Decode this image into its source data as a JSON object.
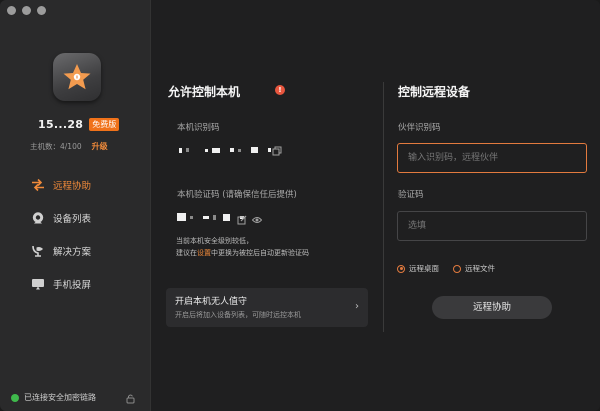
{
  "sidebar": {
    "device_id": "15...28",
    "plan_badge": "免费版",
    "hosts_label": "主机数：4/100",
    "upgrade_label": "升级",
    "nav": [
      {
        "label": "远程协助",
        "icon": "remote-assist-icon",
        "active": true
      },
      {
        "label": "设备列表",
        "icon": "device-list-icon",
        "active": false
      },
      {
        "label": "解决方案",
        "icon": "solutions-icon",
        "active": false
      },
      {
        "label": "手机投屏",
        "icon": "screen-mirror-icon",
        "active": false
      }
    ],
    "status_text": "已连接安全加密链路"
  },
  "allow": {
    "title": "允许控制本机",
    "id_label": "本机识别码",
    "code_label": "本机验证码 (请确保信任后提供)",
    "hint_line1": "当前本机安全级别较低，",
    "hint_line2_pre": "建议在",
    "hint_line2_link": "设置",
    "hint_line2_post": "中更换为被控后自动更新验证码",
    "unattended_title": "开启本机无人值守",
    "unattended_desc": "开启后将加入设备列表，可随时远控本机"
  },
  "control": {
    "title": "控制远程设备",
    "partner_label": "伙伴识别码",
    "partner_placeholder": "输入识别码，远程伙伴",
    "code_label": "验证码",
    "code_placeholder": "选填",
    "mode_desktop": "远程桌面",
    "mode_file": "远程文件",
    "connect_button": "远程协助"
  },
  "colors": {
    "accent": "#f08a3a",
    "online": "#3fb94c",
    "warning": "#e8563e"
  }
}
